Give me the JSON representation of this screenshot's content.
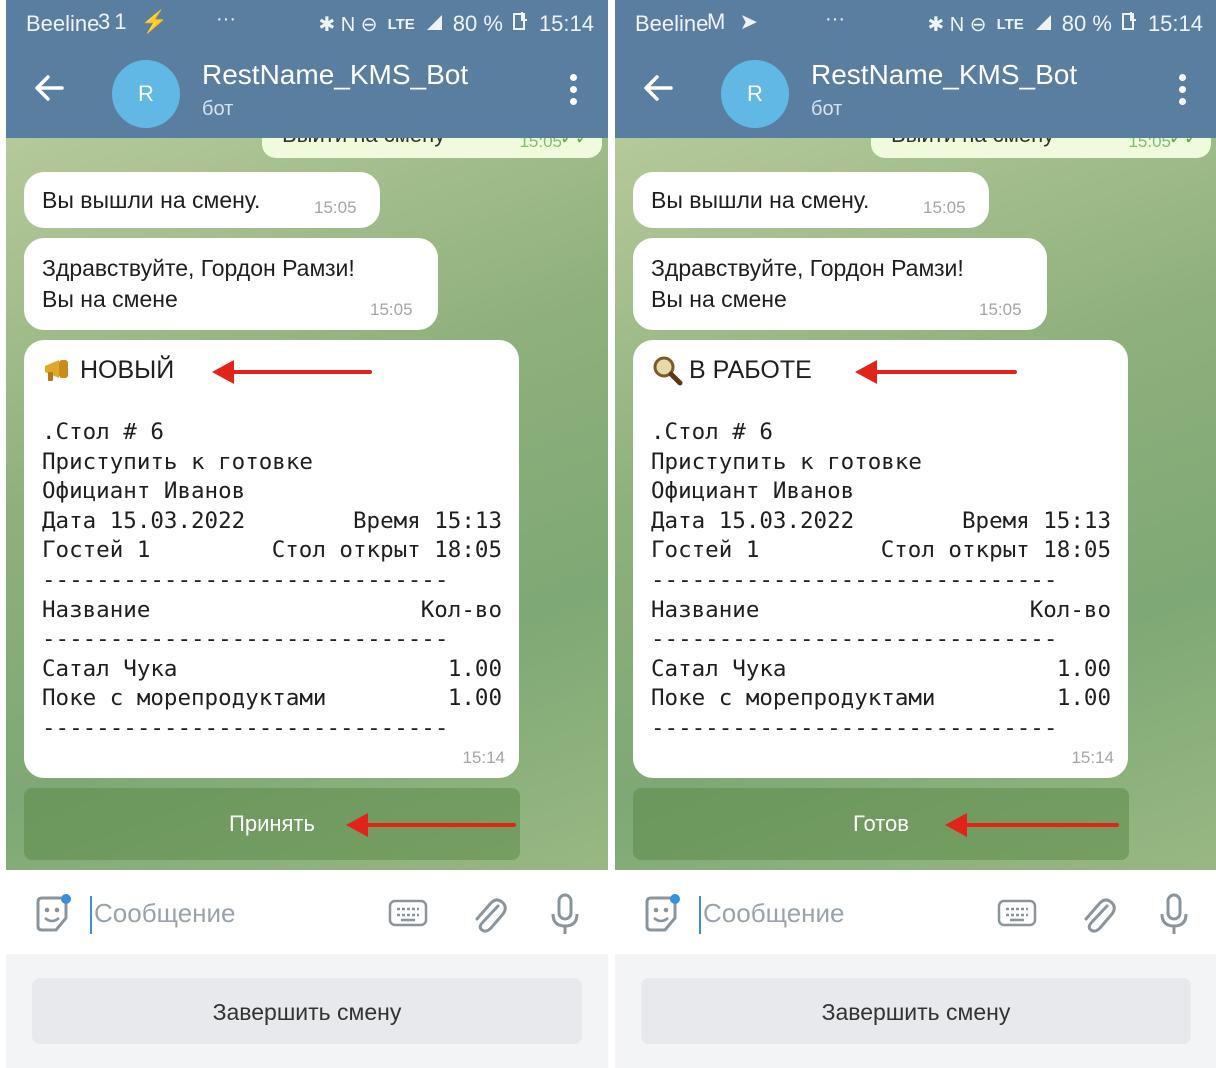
{
  "screens": [
    {
      "status_bar": {
        "carrier": "Beeline",
        "left_icons": "31 ⚡",
        "dots": "···",
        "right_icons": "✱ N ⊖",
        "network": "LTE",
        "battery": "80 %",
        "time": "15:14"
      },
      "header": {
        "avatar_letter": "R",
        "title": "RestName_KMS_Bot",
        "subtitle": "бот"
      },
      "partial_message": {
        "text": "Выйти на смену",
        "time": "15:05"
      },
      "messages": [
        {
          "text": "Вы вышли на смену.",
          "time": "15:05"
        },
        {
          "line1": "Здравствуйте, Гордон Рамзи!",
          "line2": "Вы на смене",
          "time": "15:05"
        }
      ],
      "order": {
        "status_icon": "megaphone-icon",
        "status": "НОВЫЙ",
        "table": ".Стол # 6",
        "action": "Приступить к готовке",
        "waiter": "Официант Иванов",
        "date": "Дата 15.03.2022",
        "time_label": "Время 15:13",
        "guests": "Гостей 1",
        "opened": "Стол открыт 18:05",
        "dash": "------------------------------",
        "col_name": "Название",
        "col_qty": "Кол-во",
        "items": [
          {
            "name": "Сатал Чука",
            "qty": "1.00"
          },
          {
            "name": "Поке с морепродуктами",
            "qty": "1.00"
          }
        ],
        "time": "15:14"
      },
      "inline_button": "Принять",
      "input_placeholder": "Сообщение",
      "bottom_button": "Завершить смену"
    },
    {
      "status_bar": {
        "carrier": "Beeline",
        "left_icons": "M ➤",
        "dots": "···",
        "right_icons": "✱ N ⊖",
        "network": "LTE",
        "battery": "80 %",
        "time": "15:14"
      },
      "header": {
        "avatar_letter": "R",
        "title": "RestName_KMS_Bot",
        "subtitle": "бот"
      },
      "partial_message": {
        "text": "Выйти на смену",
        "time": "15:05"
      },
      "messages": [
        {
          "text": "Вы вышли на смену.",
          "time": "15:05"
        },
        {
          "line1": "Здравствуйте, Гордон Рамзи!",
          "line2": "Вы на смене",
          "time": "15:05"
        }
      ],
      "order": {
        "status_icon": "magnifier-icon",
        "status": "В РАБОТЕ",
        "table": ".Стол # 6",
        "action": "Приступить к готовке",
        "waiter": "Официант Иванов",
        "date": "Дата 15.03.2022",
        "time_label": "Время 15:13",
        "guests": "Гостей 1",
        "opened": "Стол открыт 18:05",
        "dash": "------------------------------",
        "col_name": "Название",
        "col_qty": "Кол-во",
        "items": [
          {
            "name": "Сатал Чука",
            "qty": "1.00"
          },
          {
            "name": "Поке с морепродуктами",
            "qty": "1.00"
          }
        ],
        "time": "15:14"
      },
      "inline_button": "Готов",
      "input_placeholder": "Сообщение",
      "bottom_button": "Завершить смену"
    }
  ],
  "colors": {
    "header": "#5a7ea0",
    "accent": "#62b8e4",
    "arrow": "#e2231a",
    "bubble": "#ffffff"
  }
}
